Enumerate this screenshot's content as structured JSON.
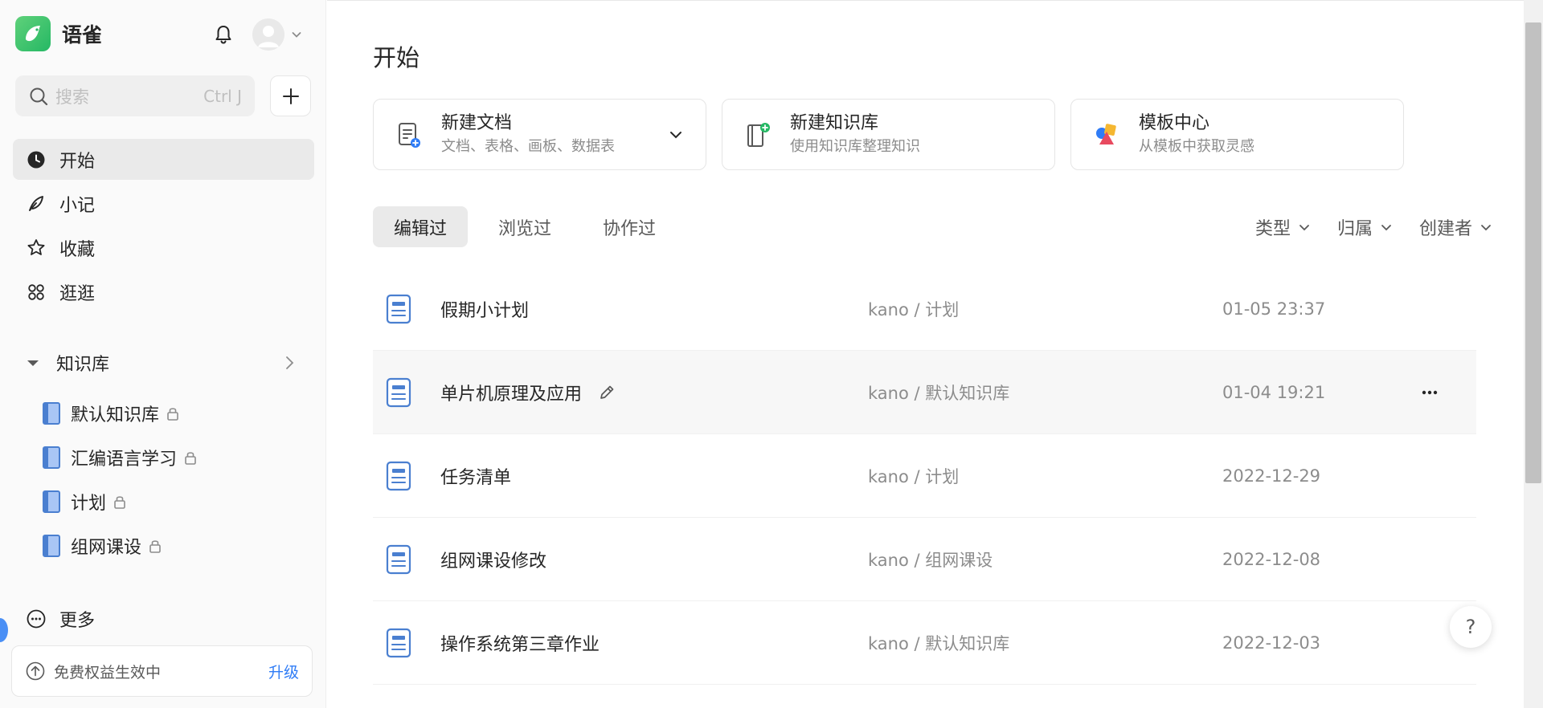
{
  "brand": {
    "name": "语雀"
  },
  "search": {
    "placeholder": "搜索",
    "shortcut": "Ctrl J"
  },
  "sidebar": {
    "nav": [
      {
        "label": "开始",
        "icon": "clock-icon",
        "active": true
      },
      {
        "label": "小记",
        "icon": "feather-icon",
        "active": false
      },
      {
        "label": "收藏",
        "icon": "star-icon",
        "active": false
      },
      {
        "label": "逛逛",
        "icon": "grid-icon",
        "active": false
      }
    ],
    "kb_title": "知识库",
    "kb_items": [
      {
        "label": "默认知识库"
      },
      {
        "label": "汇编语言学习"
      },
      {
        "label": "计划"
      },
      {
        "label": "组网课设"
      }
    ],
    "more_label": "更多",
    "upgrade_text": "免费权益生效中",
    "upgrade_link": "升级"
  },
  "main": {
    "title": "开始",
    "cards": [
      {
        "title": "新建文档",
        "subtitle": "文档、表格、画板、数据表"
      },
      {
        "title": "新建知识库",
        "subtitle": "使用知识库整理知识"
      },
      {
        "title": "模板中心",
        "subtitle": "从模板中获取灵感"
      }
    ],
    "tabs": [
      {
        "label": "编辑过",
        "active": true
      },
      {
        "label": "浏览过",
        "active": false
      },
      {
        "label": "协作过",
        "active": false
      }
    ],
    "filters": [
      {
        "label": "类型"
      },
      {
        "label": "归属"
      },
      {
        "label": "创建者"
      }
    ],
    "docs": [
      {
        "title": "假期小计划",
        "path": "kano / 计划",
        "time": "01-05 23:37"
      },
      {
        "title": "单片机原理及应用",
        "path": "kano / 默认知识库",
        "time": "01-04 19:21"
      },
      {
        "title": "任务清单",
        "path": "kano / 计划",
        "time": "2022-12-29"
      },
      {
        "title": "组网课设修改",
        "path": "kano / 组网课设",
        "time": "2022-12-08"
      },
      {
        "title": "操作系统第三章作业",
        "path": "kano / 默认知识库",
        "time": "2022-12-03"
      }
    ],
    "help_label": "?"
  },
  "colors": {
    "accent": "#2f7cf6",
    "brand_green": "#25b864",
    "doc_icon": "#4a7fd0"
  }
}
